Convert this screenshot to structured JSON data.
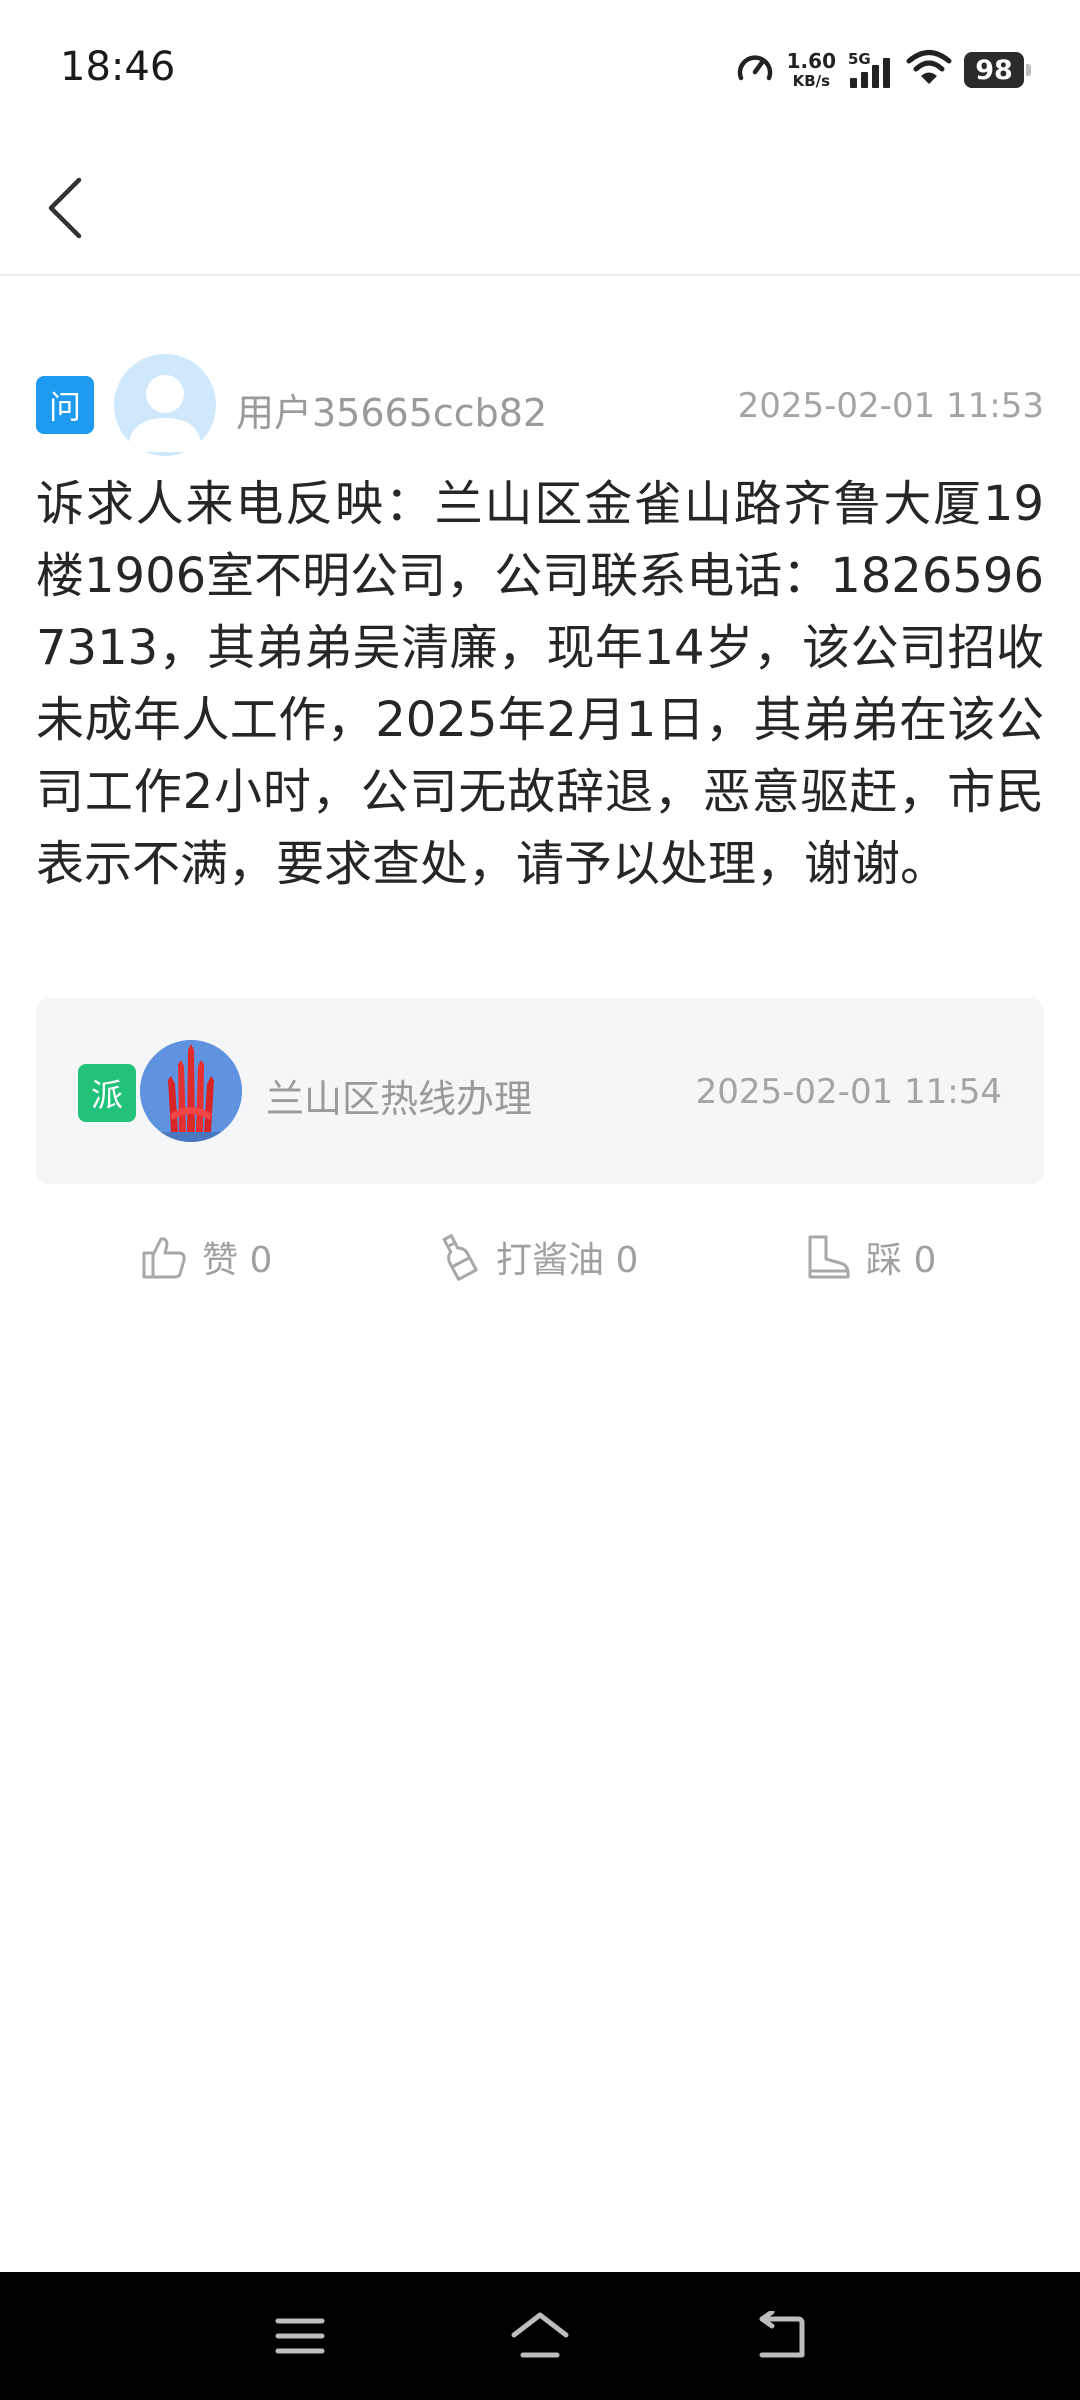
{
  "status_bar": {
    "time": "18:46",
    "net_speed_value": "1.60",
    "net_speed_unit": "KB/s",
    "network_type": "5G",
    "battery": "98"
  },
  "header": {
    "back_icon": "chevron-left-icon"
  },
  "question": {
    "badge": "问",
    "user_name": "用户35665ccb82",
    "time": "2025-02-01 11:53",
    "content": "诉求人来电反映：兰山区金雀山路齐鲁大厦19楼1906室不明公司，公司联系电话：18265967313，其弟弟吴清廉，现年14岁，该公司招收未成年人工作，2025年2月1日，其弟弟在该公司工作2小时，公司无故辞退，恶意驱赶，市民表示不满，要求查处，请予以处理，谢谢。"
  },
  "dispatch": {
    "badge": "派",
    "org_name": "兰山区热线办理",
    "time": "2025-02-01 11:54"
  },
  "actions": {
    "like": "赞 0",
    "sauce": "打酱油 0",
    "tread": "踩 0"
  },
  "colors": {
    "question_badge": "#1e9bf0",
    "dispatch_badge": "#22c27a",
    "card_bg": "#f5f6f8",
    "nav_bar": "#000000"
  }
}
